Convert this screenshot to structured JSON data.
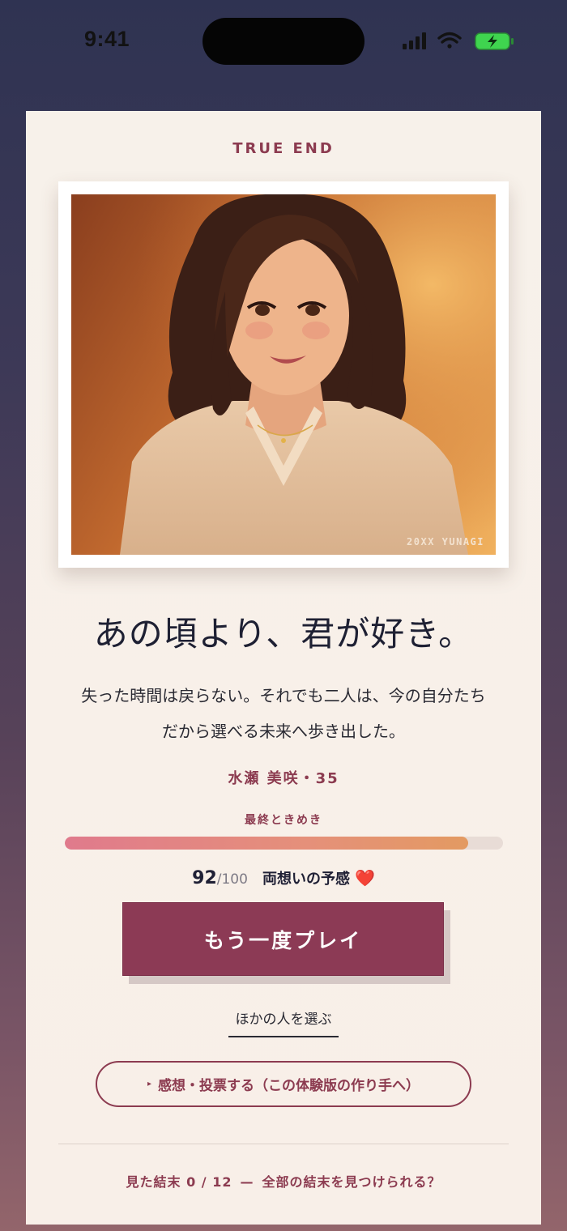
{
  "status_bar": {
    "time": "9:41",
    "icons": [
      "signal-icon",
      "wifi-icon",
      "battery-charging-icon"
    ]
  },
  "ending": {
    "eyebrow": "TRUE END",
    "image_credit": "20XX YUNAGI",
    "title": "あの頃より、君が好き。",
    "description_line1": "失った時間は戻らない。それでも二人は、今の自分たち",
    "description_line2": "だから選べる未来へ歩き出した。",
    "character": "水瀬 美咲・35"
  },
  "affection": {
    "label": "最終ときめき",
    "score": "92",
    "max": "/100",
    "fill_fraction": 0.92,
    "verdict": "両想いの予感",
    "heart": "❤️"
  },
  "actions": {
    "replay_label": "もう一度プレイ",
    "other_label": "ほかの人を選ぶ",
    "feedback_icon": "▸",
    "feedback_label": "感想・投票する（この体験版の作り手へ）"
  },
  "footer": {
    "endings_seen": "見た結末 0 / 12",
    "separator": "—",
    "prompt": "全部の結末を見つけられる？"
  },
  "colors": {
    "accent": "#8c3b50",
    "button": "#8c3a55",
    "card": "#f7f1ea"
  }
}
